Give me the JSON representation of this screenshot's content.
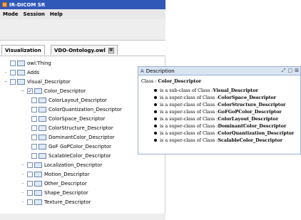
{
  "app": {
    "title": "IR-DICOM SR"
  },
  "menu": [
    "Mode",
    "Session",
    "Help"
  ],
  "tabs": [
    {
      "label": "Visualization",
      "active": true
    },
    {
      "label": "VDO-Ontology.owl",
      "active": false,
      "close": "⊠"
    }
  ],
  "tree": {
    "items": [
      {
        "label": "owl:Thing",
        "toggle": "",
        "checked": false
      },
      {
        "label": "Adds",
        "toggle": "–",
        "checked": false
      },
      {
        "label": "Visual_Descriptor",
        "toggle": "−",
        "checked": false
      },
      {
        "label": "Color_Descriptor",
        "toggle": "−",
        "checked": true
      },
      {
        "label": "ColorLayout_Descriptor",
        "toggle": "",
        "checked": false
      },
      {
        "label": "ColorQuantization_Descriptor",
        "toggle": "",
        "checked": false
      },
      {
        "label": "ColorSpace_Descriptor",
        "toggle": "",
        "checked": false
      },
      {
        "label": "ColorStructure_Descriptor",
        "toggle": "",
        "checked": false
      },
      {
        "label": "DominantColor_Descriptor",
        "toggle": "",
        "checked": false
      },
      {
        "label": "GoF GoPColor_Descriptor",
        "toggle": "",
        "checked": false
      },
      {
        "label": "ScalableColor_Descriptor",
        "toggle": "",
        "checked": false
      },
      {
        "label": "Localization_Descriptor",
        "toggle": "–",
        "checked": false
      },
      {
        "label": "Motion_Descriptor",
        "toggle": "–",
        "checked": false
      },
      {
        "label": "Other_Descriptor",
        "toggle": "–",
        "checked": false
      },
      {
        "label": "Shape_Descriptor",
        "toggle": "–",
        "checked": false
      },
      {
        "label": "Texture_Descriptor",
        "toggle": "–",
        "checked": false
      }
    ]
  },
  "description": {
    "title": "Description",
    "icon": "A",
    "controls": [
      "⤢",
      "□",
      "⊠"
    ],
    "class_prefix": "Class :",
    "class_name": "Color_Descriptor",
    "relations": [
      {
        "text": "is a sub-class of Class :",
        "target": "Visual_Descriptor"
      },
      {
        "text": "is a super-class of Class :",
        "target": "ColorSpace_Descriptor"
      },
      {
        "text": "is a super-class of Class :",
        "target": "ColorStructure_Descriptor"
      },
      {
        "text": "is a super-class of Class :",
        "target": "GoFGoPColor_Descriptor"
      },
      {
        "text": "is a super-class of Class :",
        "target": "ColorLayout_Descriptor"
      },
      {
        "text": "is a super-class of Class :",
        "target": "DominantColor_Descriptor"
      },
      {
        "text": "is a super-class of Class :",
        "target": "ColorQuantization_Descriptor"
      },
      {
        "text": "is a super-class of Class :",
        "target": "ScalableColor_Descriptor"
      }
    ]
  },
  "colors": {
    "titlebar": "#2f58b8",
    "panel_header": "#d9e4f3",
    "class_icon": "#dfe9f7"
  }
}
